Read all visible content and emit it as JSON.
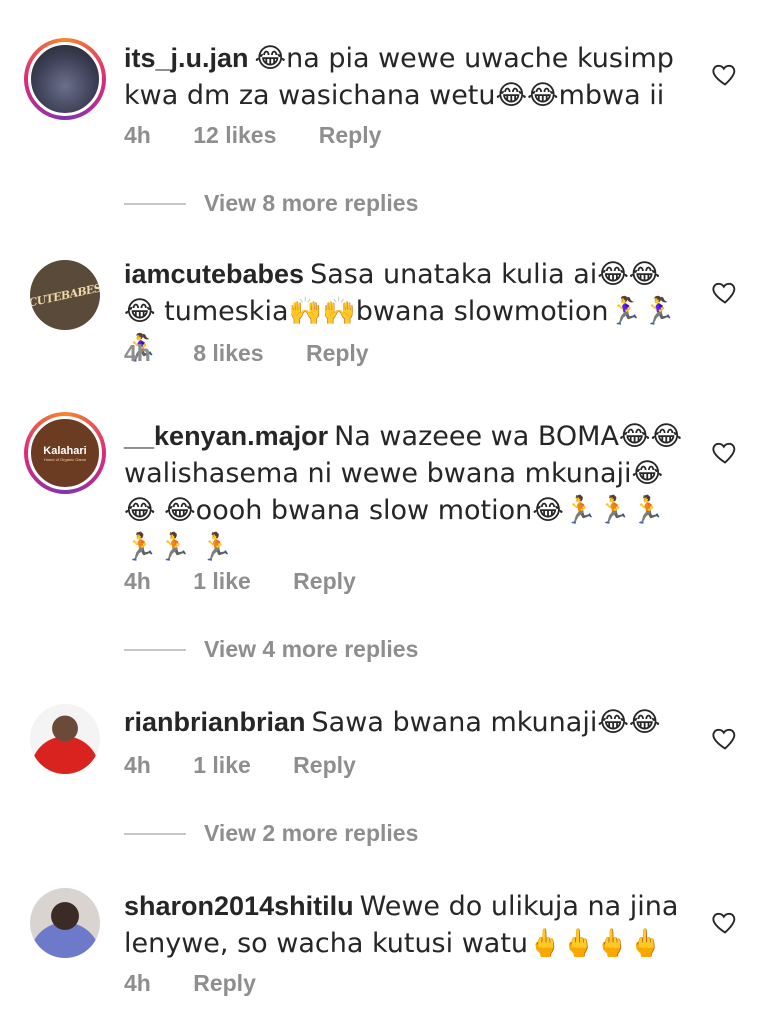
{
  "comments": [
    {
      "username": "its_j.u.jan",
      "text": "😂na pia wewe uwache kusimp kwa dm za wasichana wetu😂😂mbwa ii",
      "time": "4h",
      "likes": "12 likes",
      "reply": "Reply"
    },
    {
      "username": "iamcutebabes",
      "text": "Sasa unataka kulia ai😂😂😂 tumeskia🙌🙌bwana slowmotion🏃‍♀️🏃‍♀️🏃‍♀️",
      "time": "4h",
      "likes": "8 likes",
      "reply": "Reply",
      "avatar_text": "CUTEBABES"
    },
    {
      "username": "__kenyan.major",
      "text": "Na wazeee wa BOMA😂😂 walishasema ni wewe bwana mkunaji😂😂 😂oooh bwana slow motion😂🏃🏃🏃🏃🏃 🏃",
      "time": "4h",
      "likes": "1 like",
      "reply": "Reply",
      "avatar_text": "Kalahari",
      "avatar_sub": "Home of Organic Game"
    },
    {
      "username": "rianbrianbrian",
      "text": "Sawa bwana mkunaji😂😂",
      "time": "4h",
      "likes": "1 like",
      "reply": "Reply"
    },
    {
      "username": "sharon2014shitilu",
      "text": "Wewe do ulikuja na jina lenywe, so wacha kutusi watu🖕🖕🖕🖕",
      "time": "4h",
      "reply": "Reply"
    }
  ],
  "view_more": [
    "View 8 more replies",
    "View 4 more replies",
    "View 2 more replies"
  ],
  "colors": {
    "text": "#262626",
    "muted": "#8e8e8e",
    "ring_start": "#f58529",
    "ring_mid": "#dd2a7b"
  },
  "icons": {
    "like": "heart-outline-icon"
  }
}
